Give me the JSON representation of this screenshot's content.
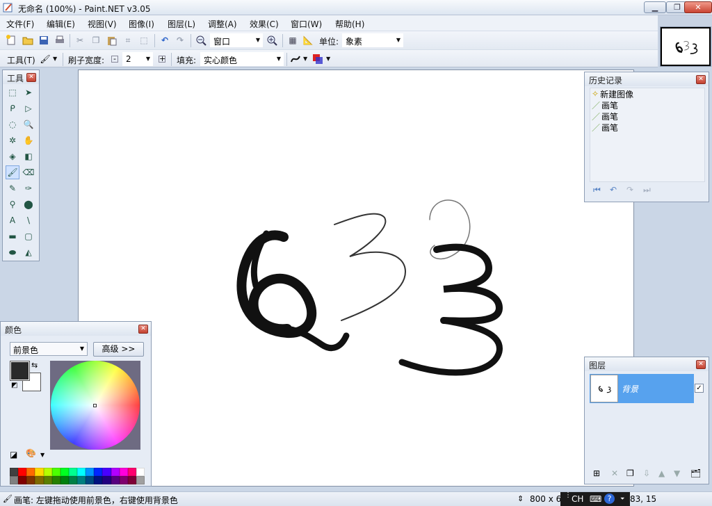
{
  "window": {
    "title": "无命名 (100%) - Paint.NET v3.05",
    "minimize_icon": "minimize-icon",
    "maximize_icon": "restore-icon",
    "close_icon": "close-icon"
  },
  "menu": [
    "文件(F)",
    "编辑(E)",
    "视图(V)",
    "图像(I)",
    "图层(L)",
    "调整(A)",
    "效果(C)",
    "窗口(W)",
    "帮助(H)"
  ],
  "toolbar": {
    "zoom_value": "窗口",
    "units_label": "单位:",
    "units_value": "象素",
    "tool_label": "工具(T)",
    "brush_width_label": "刷子宽度:",
    "brush_width_value": "2",
    "fill_label": "填充:",
    "fill_value": "实心颜色"
  },
  "tools": {
    "title": "工具",
    "items": [
      "rectangle-select-icon",
      "move-selection-icon",
      "lasso-select-icon",
      "move-selection-2-icon",
      "ellipse-select-icon",
      "zoom-icon",
      "magic-wand-icon",
      "pan-icon",
      "paint-bucket-icon",
      "gradient-icon",
      "paintbrush-icon",
      "eraser-icon",
      "pencil-icon",
      "color-picker-icon",
      "clone-stamp-icon",
      "recolor-icon",
      "text-icon",
      "line-curve-icon",
      "rectangle-icon",
      "rounded-rectangle-icon",
      "ellipse-icon",
      "freeform-shape-icon"
    ],
    "selected_index": 10
  },
  "history": {
    "title": "历史记录",
    "items": [
      "新建图像",
      "画笔",
      "画笔",
      "画笔"
    ]
  },
  "layers": {
    "title": "图层",
    "layer_name": "背景",
    "visible": true
  },
  "colors": {
    "title": "颜色",
    "mode": "前景色",
    "advanced_label": "高级 >>",
    "primary": "#2a2a2a",
    "secondary": "#ffffff",
    "palette_row1": [
      "#404040",
      "#ff0000",
      "#ff6a00",
      "#ffd800",
      "#b6ff00",
      "#4cff00",
      "#00ff21",
      "#00ff90",
      "#00ffff",
      "#0094ff",
      "#0026ff",
      "#4800ff",
      "#b200ff",
      "#ff00dc",
      "#ff006e",
      "#ffffff"
    ],
    "palette_row2": [
      "#808080",
      "#7f0000",
      "#7f3300",
      "#7f6a00",
      "#5b7f00",
      "#267f00",
      "#007f0e",
      "#007f46",
      "#007f7f",
      "#004a7f",
      "#00137f",
      "#21007f",
      "#57007f",
      "#7f006e",
      "#7f0037",
      "#a0a0a0"
    ]
  },
  "status": {
    "message": "画笔: 左键拖动使用前景色，右键使用背景色",
    "image_size": "800 x 6",
    "ime_lang": "CH",
    "cursor_pos": "83, 15"
  }
}
